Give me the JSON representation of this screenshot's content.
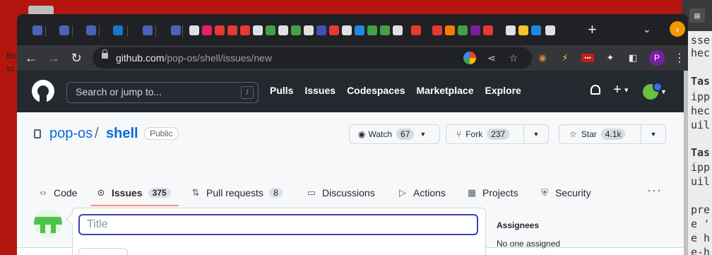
{
  "desktop": {
    "left_text_1": "Bo",
    "left_text_2": "sc"
  },
  "terminal_fragments": [
    "sse",
    "hec",
    "Tas",
    "ipp",
    "hec",
    "uil",
    "Tas",
    "ipp",
    "uil",
    "pre",
    "e '",
    "e h",
    "e-h"
  ],
  "browser": {
    "tab_count_icons": 33,
    "new_tab": "+",
    "tab_search": "⌄",
    "update_icon": "›",
    "url_host": "github.com",
    "url_path": "/pop-os/shell/issues/new",
    "profile_initial": "P",
    "menu": "⋮"
  },
  "github": {
    "search_placeholder": "Search or jump to...",
    "search_shortcut": "/",
    "nav": [
      "Pulls",
      "Issues",
      "Codespaces",
      "Marketplace",
      "Explore"
    ],
    "repo_owner": "pop-os",
    "repo_sep": "/",
    "repo_name": "shell",
    "visibility": "Public",
    "watch_label": "Watch",
    "watch_count": "67",
    "fork_label": "Fork",
    "fork_count": "237",
    "star_label": "Star",
    "star_count": "4.1k",
    "tabs": [
      {
        "label": "Code",
        "icon": "code-icon"
      },
      {
        "label": "Issues",
        "icon": "issue-icon",
        "count": "375"
      },
      {
        "label": "Pull requests",
        "icon": "pull-request-icon",
        "count": "8"
      },
      {
        "label": "Discussions",
        "icon": "discussion-icon"
      },
      {
        "label": "Actions",
        "icon": "play-icon"
      },
      {
        "label": "Projects",
        "icon": "table-icon"
      },
      {
        "label": "Security",
        "icon": "shield-icon"
      }
    ],
    "more": "···",
    "title_placeholder": "Title",
    "sidebar": {
      "assignees_heading": "Assignees",
      "assignees_value": "No one assigned"
    }
  }
}
